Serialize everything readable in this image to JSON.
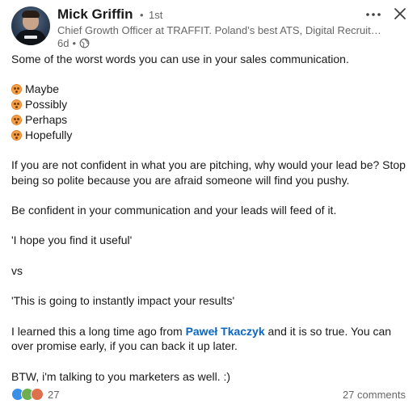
{
  "author": {
    "name": "Mick Griffin",
    "separator": "•",
    "degree": "1st",
    "headline": "Chief Growth Officer at TRAFFIT. Poland’s best ATS, Digital Recruit…",
    "time": "6d",
    "visibility_icon": "globe-icon"
  },
  "controls": {
    "more_icon": "more-horizontal-icon",
    "close_icon": "close-icon"
  },
  "post": {
    "intro": "Some of the worst words you can use in your sales communication.",
    "words": [
      "Maybe",
      "Possibly",
      "Perhaps",
      "Hopefully"
    ],
    "emoji_icon": "astonished-face-icon",
    "para1": "If you are not confident in what you are pitching, why would your lead be? Stop being so polite because you are afraid someone will find you pushy.",
    "para2": "Be confident in your communication and your leads will feed of it.",
    "quote1": "'I hope you find it useful'",
    "vs": "vs",
    "quote2": "'This is going to instantly impact your results'",
    "para3_before": "I learned this a long time ago from ",
    "mention": "Paweł Tkaczyk",
    "para3_after": " and it is so true. You can over promise early, if you can back it up later.",
    "para4": "BTW, i'm talking to you marketers as well. :)"
  },
  "social": {
    "reactions": [
      "like",
      "celebrate",
      "love"
    ],
    "reaction_count": "27",
    "comments": "27 comments"
  },
  "colors": {
    "link": "#0a66c2",
    "text": "#191919",
    "secondary": "#666666"
  }
}
